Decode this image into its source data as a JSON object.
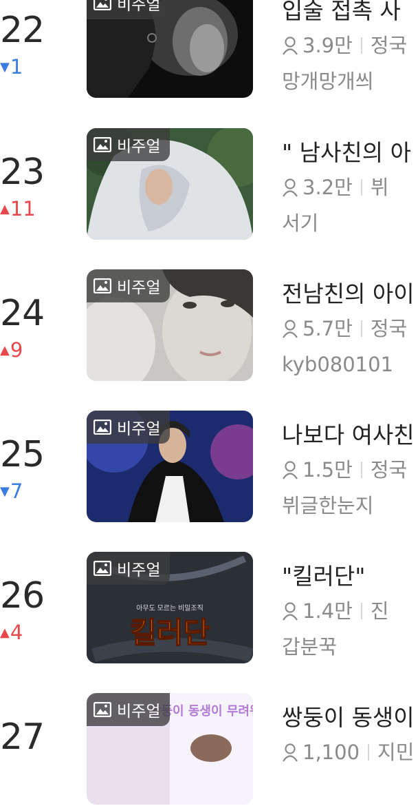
{
  "badge_label": "비주얼",
  "icons": {
    "badge": "image-icon",
    "views": "person-icon",
    "up": "triangle-up-icon",
    "down": "triangle-down-icon"
  },
  "colors": {
    "up": "#e8474b",
    "down": "#3b7de0",
    "rank": "#2a2a2a",
    "meta": "#8a8a8a"
  },
  "items": [
    {
      "rank": "22",
      "change_dir": "down",
      "change": "1",
      "title": "입술 접촉 사",
      "views": "3.9만",
      "tag": "정국",
      "author": "망개망개씌"
    },
    {
      "rank": "23",
      "change_dir": "up",
      "change": "11",
      "title": "\" 남사친의 아",
      "views": "3.2만",
      "tag": "뷔",
      "author": "서기"
    },
    {
      "rank": "24",
      "change_dir": "up",
      "change": "9",
      "title": "전남친의 아이",
      "views": "5.7만",
      "tag": "정국",
      "author": "kyb080101"
    },
    {
      "rank": "25",
      "change_dir": "down",
      "change": "7",
      "title": "나보다 여사친",
      "views": "1.5만",
      "tag": "정국",
      "author": "뷔글한눈지"
    },
    {
      "rank": "26",
      "change_dir": "up",
      "change": "4",
      "title": "\"킬러단\"",
      "views": "1.4만",
      "tag": "진",
      "author": "갑분꾹",
      "cover_text": "킬러단",
      "cover_subtext": "아무도 모르는 비밀조직"
    },
    {
      "rank": "27",
      "change_dir": "",
      "change": "",
      "title": "쌍둥이 동생이",
      "views": "1,100",
      "tag": "지민",
      "author": "",
      "cover_text": "쌍둥이 동생이 무려워요"
    }
  ]
}
